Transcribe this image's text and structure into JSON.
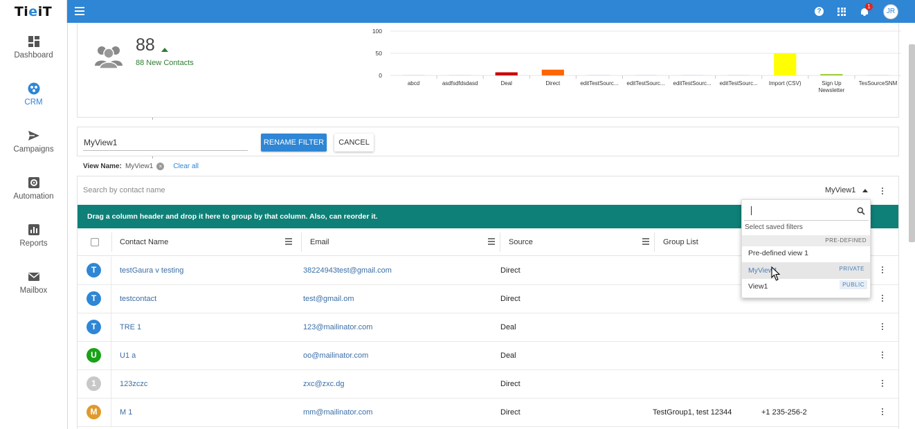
{
  "app": {
    "logo_pre": "Ti",
    "logo_dot": "e",
    "logo_post": "iT",
    "notif_count": "1",
    "user_initials": "JR",
    "help_glyph": "?"
  },
  "sidebar": {
    "items": [
      {
        "label": "Dashboard",
        "icon": "dashboard-icon"
      },
      {
        "label": "CRM",
        "icon": "crm-icon",
        "active": true
      },
      {
        "label": "Campaigns",
        "icon": "send-icon"
      },
      {
        "label": "Automation",
        "icon": "gear-icon"
      },
      {
        "label": "Reports",
        "icon": "bar-chart-icon"
      },
      {
        "label": "Mailbox",
        "icon": "mail-icon"
      }
    ]
  },
  "stats": {
    "count": "88",
    "new_contacts": "88 New Contacts"
  },
  "chart_data": {
    "type": "bar",
    "title": "",
    "xlabel": "",
    "ylabel": "",
    "ylim": [
      0,
      100
    ],
    "yticks": [
      "100",
      "50",
      "0"
    ],
    "categories": [
      "abcd",
      "asdfsdfdsdasd",
      "Deal",
      "Direct",
      "editTestSourc...",
      "editTestSourc...",
      "editTestSourc...",
      "editTestSourc...",
      "Import (CSV)",
      "Sign Up Newsletter",
      "TesSourceSNM"
    ],
    "category_lines": [
      [
        "abcd"
      ],
      [
        "asdfsdfdsdasd"
      ],
      [
        "Deal"
      ],
      [
        "Direct"
      ],
      [
        "editTestSourc..."
      ],
      [
        "editTestSourc..."
      ],
      [
        "editTestSourc..."
      ],
      [
        "editTestSourc..."
      ],
      [
        "Import (CSV)"
      ],
      [
        "Sign Up",
        "Newsletter"
      ],
      [
        "TesSourceSNM"
      ]
    ],
    "values": [
      0,
      0,
      7,
      13,
      0,
      0,
      0,
      0,
      50,
      3,
      0
    ],
    "colors": [
      "#ccc",
      "#ccc",
      "#cc0000",
      "#ff6600",
      "#ccc",
      "#ccc",
      "#ccc",
      "#ccc",
      "#ffff00",
      "#99cc33",
      "#ccc"
    ]
  },
  "rename": {
    "input_value": "MyView1",
    "rename_label": "RENAME FILTER",
    "cancel_label": "CANCEL"
  },
  "viewname": {
    "label": "View Name:",
    "value": "MyView1",
    "remove_glyph": "×",
    "clear_all": "Clear all"
  },
  "grid": {
    "search_placeholder": "Search by contact name",
    "selected_view": "MyView1",
    "group_hint": "Drag a column header and drop it here to group by that column. Also, can reorder it.",
    "columns": [
      "Contact Name",
      "Email",
      "Source",
      "Group List"
    ],
    "rows": [
      {
        "initial": "T",
        "color": "#2e86d5",
        "name": "testGaura v testing",
        "email": "38224943test@gmail.com",
        "source": "Direct",
        "group": "",
        "phone": ""
      },
      {
        "initial": "T",
        "color": "#2e86d5",
        "name": "testcontact",
        "email": "test@gmail.om",
        "source": "Direct",
        "group": "",
        "phone": ""
      },
      {
        "initial": "T",
        "color": "#2e86d5",
        "name": "TRE 1",
        "email": "123@mailinator.com",
        "source": "Deal",
        "group": "",
        "phone": ""
      },
      {
        "initial": "U",
        "color": "#17a317",
        "name": "U1 a",
        "email": "oo@mailinator.com",
        "source": "Deal",
        "group": "",
        "phone": ""
      },
      {
        "initial": "1",
        "color": "#c8c8c8",
        "name": "123zczc",
        "email": "zxc@zxc.dg",
        "source": "Direct",
        "group": "",
        "phone": ""
      },
      {
        "initial": "M",
        "color": "#e09a2c",
        "name": "M 1",
        "email": "mm@mailinator.com",
        "source": "Direct",
        "group": "TestGroup1, test 12344",
        "phone": "+1 235-256-2"
      }
    ]
  },
  "dropdown": {
    "title": "Select saved filters",
    "predefined_tag": "PRE-DEFINED",
    "items": [
      {
        "label": "Pre-defined view 1",
        "tag": ""
      },
      {
        "label": "MyView1",
        "tag": "PRIVATE"
      },
      {
        "label": "View1",
        "tag": "PUBLIC"
      }
    ]
  }
}
